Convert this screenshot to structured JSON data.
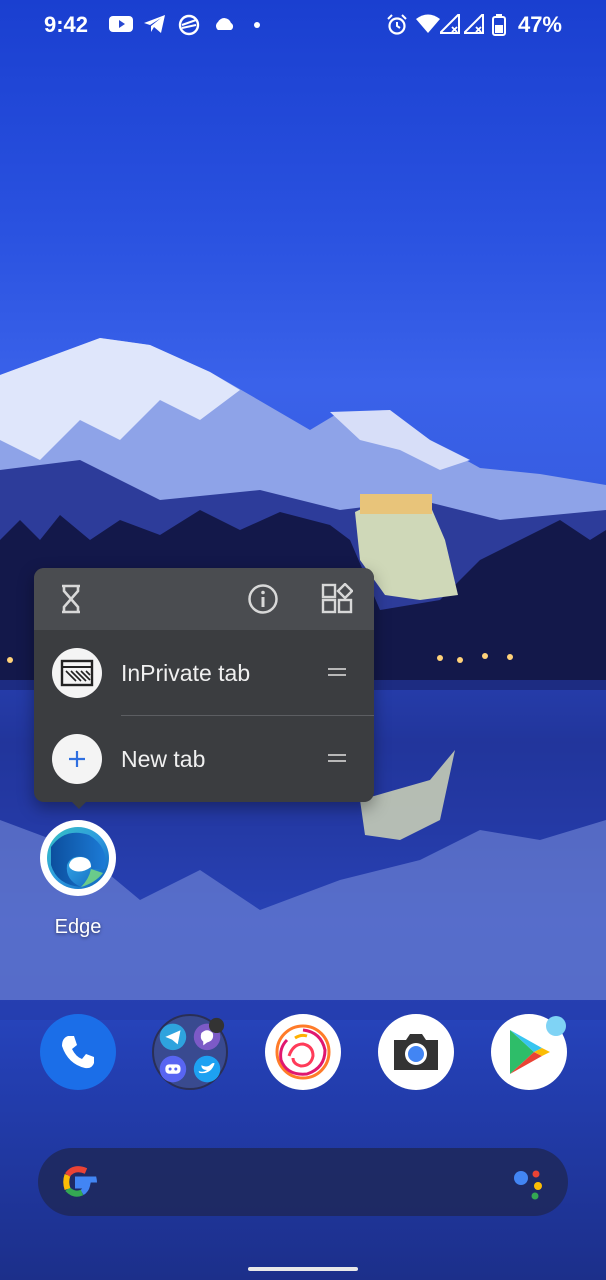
{
  "status_bar": {
    "time": "9:42",
    "battery_percent": "47%",
    "notification_icons": [
      "youtube-icon",
      "telegram-icon",
      "vpn-icon",
      "cloud-icon",
      "dot-icon"
    ],
    "system_icons": [
      "alarm-icon",
      "wifi-icon",
      "signal-icon",
      "signal-icon",
      "battery-icon"
    ]
  },
  "popup": {
    "top_icons": [
      "hourglass-icon",
      "info-icon",
      "widgets-icon"
    ],
    "shortcuts": [
      {
        "label": "InPrivate tab",
        "icon": "inprivate-icon"
      },
      {
        "label": "New tab",
        "icon": "plus-icon"
      }
    ]
  },
  "edge_app": {
    "label": "Edge"
  },
  "dock": [
    "phone-icon",
    "social-folder-icon",
    "firefox-icon",
    "camera-icon",
    "play-store-icon"
  ],
  "search": {
    "placeholder": ""
  },
  "colors": {
    "accent_blue": "#1b6ee8",
    "popup_bg": "#3b3d40",
    "popup_top": "#4a4c50"
  }
}
